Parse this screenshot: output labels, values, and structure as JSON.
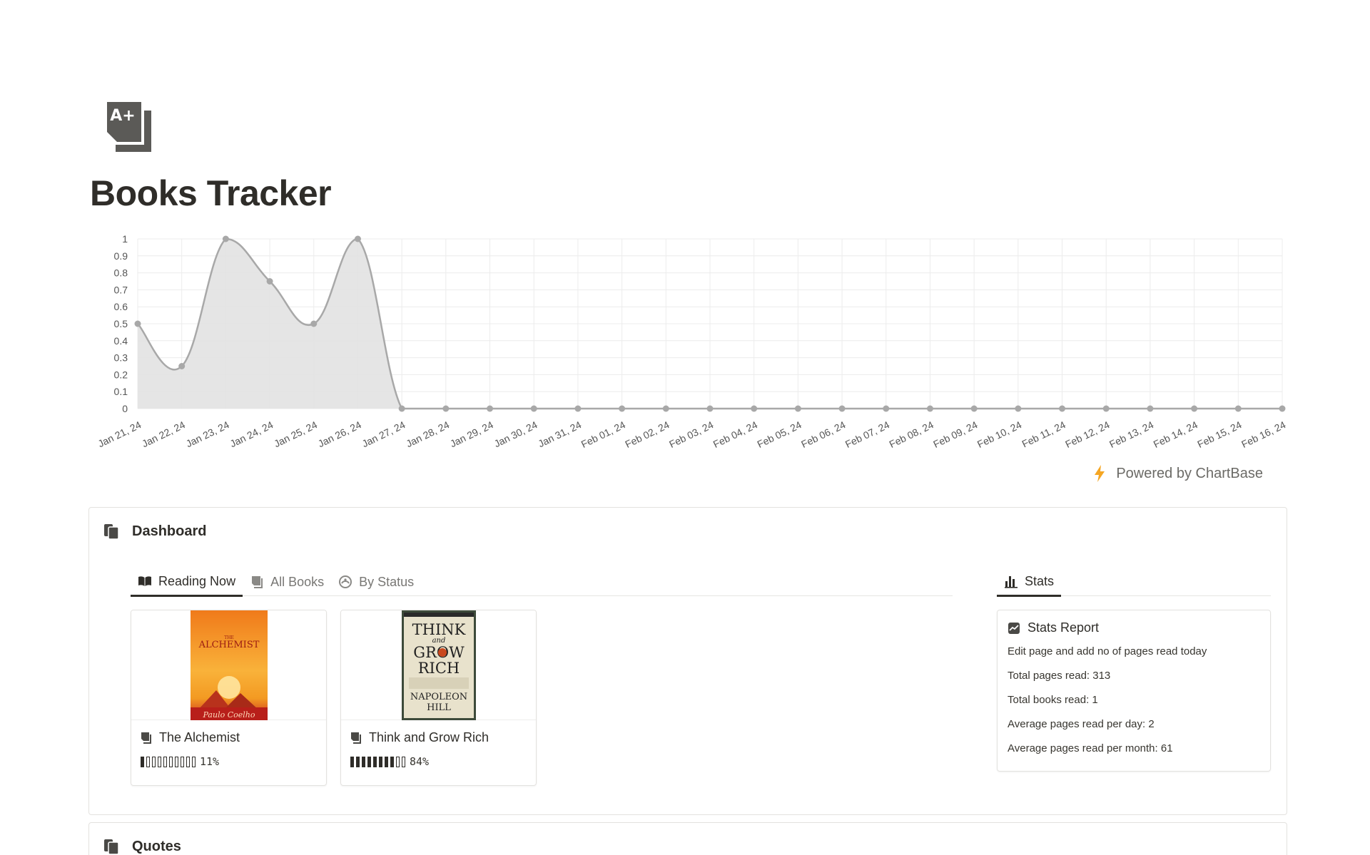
{
  "page": {
    "title": "Books Tracker",
    "icon": "book-a-plus-icon"
  },
  "chart_data": {
    "type": "area",
    "x": [
      "Jan 21, 24",
      "Jan 22, 24",
      "Jan 23, 24",
      "Jan 24, 24",
      "Jan 25, 24",
      "Jan 26, 24",
      "Jan 27, 24",
      "Jan 28, 24",
      "Jan 29, 24",
      "Jan 30, 24",
      "Jan 31, 24",
      "Feb 01, 24",
      "Feb 02, 24",
      "Feb 03, 24",
      "Feb 04, 24",
      "Feb 05, 24",
      "Feb 06, 24",
      "Feb 07, 24",
      "Feb 08, 24",
      "Feb 09, 24",
      "Feb 10, 24",
      "Feb 11, 24",
      "Feb 12, 24",
      "Feb 13, 24",
      "Feb 14, 24",
      "Feb 15, 24",
      "Feb 16, 24"
    ],
    "series": [
      {
        "values": [
          0.5,
          0.25,
          1,
          0.75,
          0.5,
          1,
          0,
          0,
          0,
          0,
          0,
          0,
          0,
          0,
          0,
          0,
          0,
          0,
          0,
          0,
          0,
          0,
          0,
          0,
          0,
          0,
          0
        ]
      }
    ],
    "yticks": [
      "0",
      "0.1",
      "0.2",
      "0.3",
      "0.4",
      "0.5",
      "0.6",
      "0.7",
      "0.8",
      "0.9",
      "1"
    ],
    "ylim": [
      0,
      1
    ],
    "grid": true,
    "colors": {
      "line": "#a8a8a8",
      "fill": "#e2e2e2",
      "grid": "#ececec",
      "tick": "#555555"
    }
  },
  "powered_by": {
    "label": "Powered by ChartBase",
    "color": "#f5a623"
  },
  "dashboard": {
    "title": "Dashboard",
    "tabs": [
      {
        "label": "Reading Now",
        "icon": "open-book-icon",
        "active": true
      },
      {
        "label": "All Books",
        "icon": "book-icon",
        "active": false
      },
      {
        "label": "By Status",
        "icon": "status-circle-icon",
        "active": false
      }
    ],
    "books": [
      {
        "title": "The Alchemist",
        "progress": 0.11,
        "progress_text": "11%",
        "cover_title": "THE ALCHEMIST",
        "cover_author": "Paulo Coelho"
      },
      {
        "title": "Think and Grow Rich",
        "progress": 0.84,
        "progress_text": "84%",
        "cover_title": "THINK and GROW RICH",
        "cover_author": "NAPOLEON HILL"
      }
    ],
    "stats_tab": {
      "label": "Stats",
      "icon": "bar-chart-icon"
    },
    "stats": {
      "title": "Stats Report",
      "lines": [
        "Edit page and add no of pages read today",
        "Total pages read: 313",
        "Total books read: 1",
        "Average pages read per day: 2",
        "Average pages read per month: 61"
      ]
    }
  },
  "quotes": {
    "title": "Quotes"
  }
}
